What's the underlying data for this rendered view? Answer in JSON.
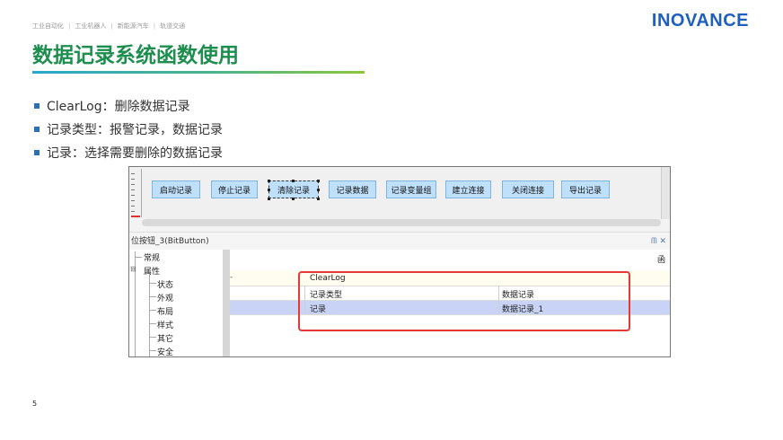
{
  "header": {
    "nav": [
      "工业自动化",
      "工业机器人",
      "新能源汽车",
      "轨道交通"
    ],
    "nav_sep": "|",
    "logo": "INOVANCE",
    "title": "数据记录系统函数使用",
    "brand_color": "#1f5fbf",
    "title_color": "#1e8e4f"
  },
  "bullets": [
    "ClearLog：删除数据记录",
    "记录类型：报警记录，数据记录",
    "记录：选择需要删除的数据记录"
  ],
  "screenshot": {
    "toolbar_buttons": [
      "启动记录",
      "停止记录",
      "清除记录",
      "记录数据",
      "记录变量组",
      "建立连接",
      "关闭连接",
      "导出记录"
    ],
    "selected_button": "清除记录",
    "panel_title": "位按钮_3(BitButton)",
    "panel_controls": "ᗰ ✕",
    "tree": {
      "items": [
        "常规",
        "属性",
        "状态",
        "外观",
        "布局",
        "样式",
        "其它",
        "安全"
      ],
      "collapse_glyph": "⊟"
    },
    "grid": {
      "top_right_fragment": "函",
      "arrow_marker": "-",
      "rows": [
        {
          "name": "ClearLog",
          "value": ""
        },
        {
          "name": "记录类型",
          "value": "数据记录"
        },
        {
          "name": "记录",
          "value": "数据记录_1"
        }
      ]
    }
  },
  "page_number": "5"
}
